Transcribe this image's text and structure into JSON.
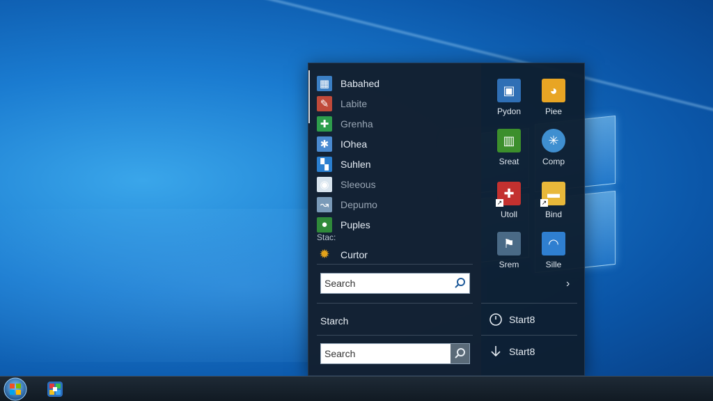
{
  "desktop": {
    "background": "#1a7bd0"
  },
  "start_menu": {
    "programs": [
      {
        "label": "Babahed",
        "icon": "image-viewer-icon",
        "color": "#3b7fc4",
        "dim": false
      },
      {
        "label": "Labite",
        "icon": "paint-icon",
        "color": "#c04a3a",
        "dim": true
      },
      {
        "label": "Grenha",
        "icon": "puzzle-icon",
        "color": "#2e9d4c",
        "dim": true
      },
      {
        "label": "IOhea",
        "icon": "pinwheel-icon",
        "color": "#4a8ad0",
        "dim": false
      },
      {
        "label": "Suhlen",
        "icon": "grid-app-icon",
        "color": "#2a7fd0",
        "dim": false
      },
      {
        "label": "Sleeous",
        "icon": "disc-icon",
        "color": "#d8e4ee",
        "dim": true
      },
      {
        "label": "Depumo",
        "icon": "swirl-icon",
        "color": "#7a9ab8",
        "dim": true
      },
      {
        "label": "Puples",
        "icon": "green-circle-icon",
        "color": "#2f8a3a",
        "dim": false
      }
    ],
    "section_label": "Stac:",
    "cursor_item": {
      "label": "Curtor",
      "icon": "sun-icon",
      "color": "#e3a21a"
    },
    "search_top": {
      "placeholder": "Search"
    },
    "middle_label": "Starch",
    "search_bottom": {
      "placeholder": "Search"
    },
    "tiles": [
      {
        "label": "Pydon",
        "icon": "python-app-icon",
        "color": "#2f6fb5",
        "shortcut": false
      },
      {
        "label": "Piee",
        "icon": "chrome-icon",
        "color": "#e8a524",
        "shortcut": false
      },
      {
        "label": "Sreat",
        "icon": "spreadsheet-icon",
        "color": "#3c8f2c",
        "shortcut": false
      },
      {
        "label": "Comp",
        "icon": "network-icon",
        "color": "#3f8fd0",
        "shortcut": false
      },
      {
        "label": "Utoll",
        "icon": "shield-app-icon",
        "color": "#c3312f",
        "shortcut": true
      },
      {
        "label": "Bind",
        "icon": "folder-icon",
        "color": "#e8b83a",
        "shortcut": true
      },
      {
        "label": "Srem",
        "icon": "flag-app-icon",
        "color": "#4a6a86",
        "shortcut": false
      },
      {
        "label": "Sille",
        "icon": "wifi-app-icon",
        "color": "#2f7fd0",
        "shortcut": false
      }
    ],
    "more_arrow": "›",
    "power": [
      {
        "label": "Start8",
        "icon": "power-icon"
      },
      {
        "label": "Start8",
        "icon": "download-arrow-icon"
      }
    ]
  },
  "taskbar": {
    "start_icon": "windows-orb-icon",
    "apps": [
      {
        "icon": "colorful-app-icon"
      }
    ]
  }
}
